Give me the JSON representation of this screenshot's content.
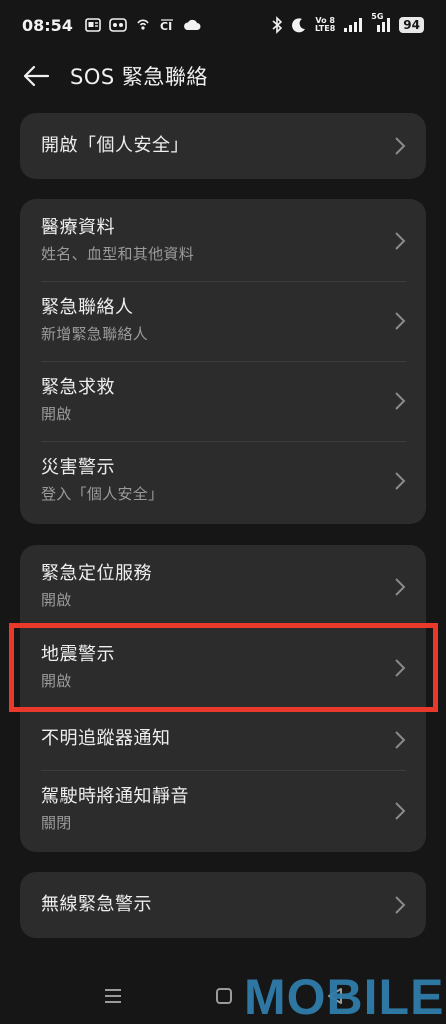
{
  "status_bar": {
    "time": "08:54",
    "battery": "94",
    "network_top": "Vo 8",
    "network_bottom": "LTE8",
    "signal_label": "5G"
  },
  "header": {
    "back_icon": "arrow-left-icon",
    "title": "SOS 緊急聯絡"
  },
  "cards": [
    {
      "items": [
        {
          "title": "開啟「個人安全」",
          "subtitle": ""
        }
      ]
    },
    {
      "items": [
        {
          "title": "醫療資料",
          "subtitle": "姓名、血型和其他資料"
        },
        {
          "title": "緊急聯絡人",
          "subtitle": "新增緊急聯絡人"
        },
        {
          "title": "緊急求救",
          "subtitle": "開啟"
        },
        {
          "title": "災害警示",
          "subtitle": "登入「個人安全」"
        }
      ]
    },
    {
      "items": [
        {
          "title": "緊急定位服務",
          "subtitle": "開啟"
        },
        {
          "title": "地震警示",
          "subtitle": "開啟"
        },
        {
          "title": "不明追蹤器通知",
          "subtitle": ""
        },
        {
          "title": "駕駛時將通知靜音",
          "subtitle": "關閉"
        }
      ]
    },
    {
      "items": [
        {
          "title": "無線緊急警示",
          "subtitle": ""
        }
      ]
    }
  ],
  "highlight_color": "#e8392a",
  "watermark": "MOBILE",
  "nav": {
    "menu_icon": "menu-icon",
    "home_icon": "home-square-icon",
    "back_icon": "back-triangle-icon"
  }
}
